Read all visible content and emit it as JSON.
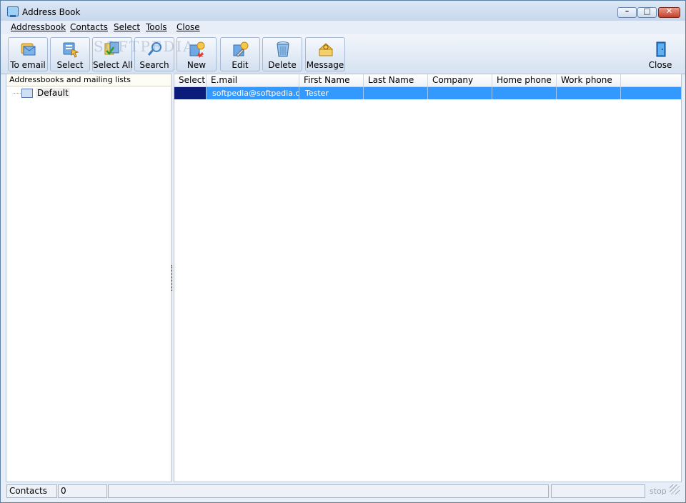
{
  "window": {
    "title": "Address Book"
  },
  "menu": [
    {
      "label": "Addressbook"
    },
    {
      "label": "Contacts"
    },
    {
      "label": "Select"
    },
    {
      "label": "Tools"
    },
    {
      "label": "Close"
    }
  ],
  "toolbar": {
    "buttons": [
      {
        "label": "To email",
        "icon": "to-email-icon"
      },
      {
        "label": "Select",
        "icon": "select-icon"
      },
      {
        "label": "Select All",
        "icon": "select-all-icon"
      },
      {
        "label": "Search",
        "icon": "search-icon"
      },
      {
        "label": "New",
        "icon": "new-contact-icon"
      },
      {
        "label": "Edit",
        "icon": "edit-contact-icon"
      },
      {
        "label": "Delete",
        "icon": "trash-icon"
      },
      {
        "label": "Message",
        "icon": "message-icon"
      }
    ],
    "close_label": "Close",
    "watermark": "SOFTPEDIA"
  },
  "left_panel": {
    "header": "Addressbooks and mailing lists",
    "tree": [
      {
        "label": "Default"
      }
    ]
  },
  "grid": {
    "columns": [
      "Select",
      "E.mail",
      "First Name",
      "Last Name",
      "Company",
      "Home phone",
      "Work phone"
    ],
    "rows": [
      {
        "select": "",
        "email": "softpedia@softpedia.c...",
        "first_name": "Tester",
        "last_name": "",
        "company": "",
        "home_phone": "",
        "work_phone": ""
      }
    ]
  },
  "status": {
    "label": "Contacts",
    "count": "0",
    "stop": "stop"
  },
  "colors": {
    "selection": "#3399ff",
    "select_cell": "#0a1b7a",
    "chrome": "#e8eef7"
  }
}
